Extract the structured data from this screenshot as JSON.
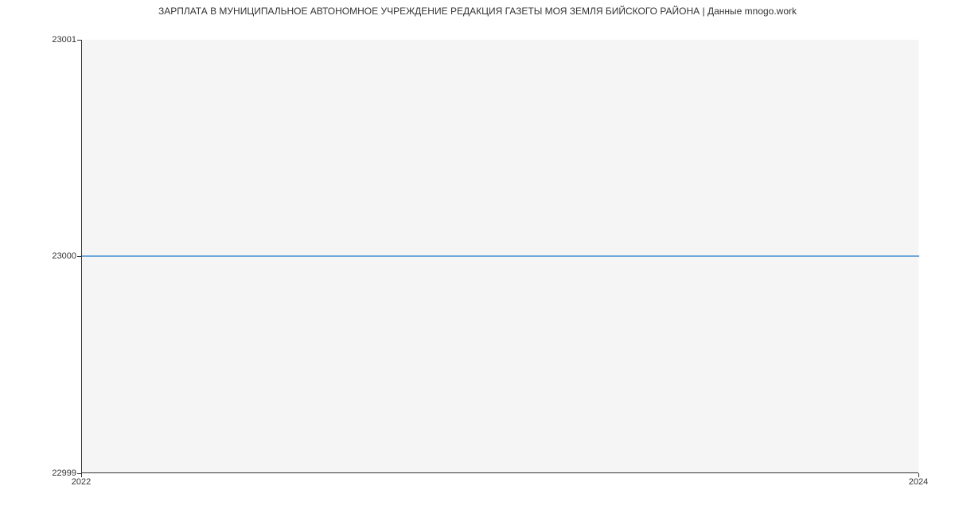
{
  "chart_data": {
    "type": "line",
    "title": "ЗАРПЛАТА В МУНИЦИПАЛЬНОЕ АВТОНОМНОЕ УЧРЕЖДЕНИЕ РЕДАКЦИЯ ГАЗЕТЫ МОЯ ЗЕМЛЯ БИЙСКОГО РАЙОНА | Данные mnogo.work",
    "x": [
      2022,
      2024
    ],
    "values": [
      23000,
      23000
    ],
    "xlabel": "",
    "ylabel": "",
    "xlim": [
      2022,
      2024
    ],
    "ylim": [
      22999,
      23001
    ],
    "y_ticks": [
      22999,
      23000,
      23001
    ],
    "x_ticks": [
      2022,
      2024
    ],
    "line_color": "#6fa8dc"
  }
}
